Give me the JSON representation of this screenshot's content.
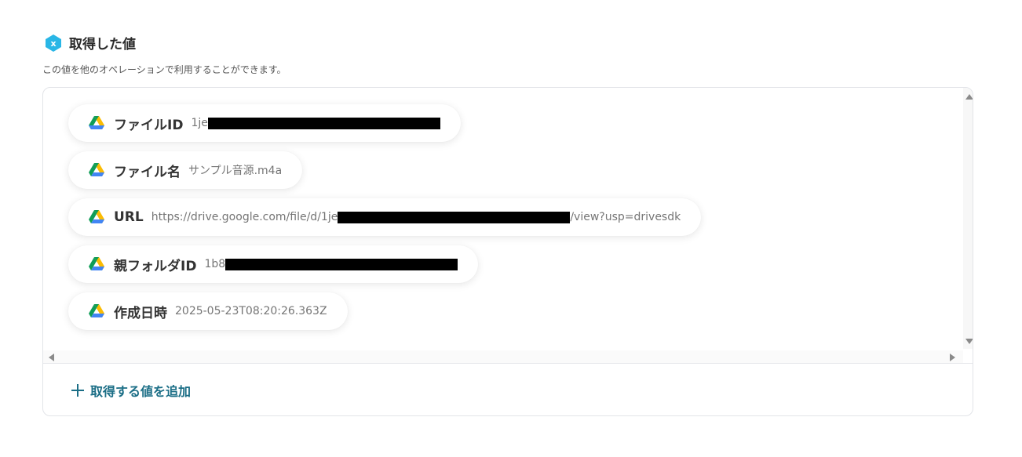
{
  "header": {
    "title": "取得した値",
    "description": "この値を他のオペレーションで利用することができます。",
    "icon": "x-variable-icon",
    "accent_color": "#29b6e6"
  },
  "fields": [
    {
      "label": "ファイルID",
      "value_prefix": "1je",
      "value_suffix": "",
      "redacted": true
    },
    {
      "label": "ファイル名",
      "value_prefix": "サンプル音源.m4a",
      "value_suffix": "",
      "redacted": false
    },
    {
      "label": "URL",
      "value_prefix": "https://drive.google.com/file/d/1je",
      "value_suffix": "/view?usp=drivesdk",
      "redacted": true
    },
    {
      "label": "親フォルダID",
      "value_prefix": "1b8",
      "value_suffix": "",
      "redacted": true
    },
    {
      "label": "作成日時",
      "value_prefix": "2025-05-23T08:20:26.363Z",
      "value_suffix": "",
      "redacted": false
    }
  ],
  "add_value": {
    "label": "取得する値を追加",
    "color": "#1b6e86"
  }
}
